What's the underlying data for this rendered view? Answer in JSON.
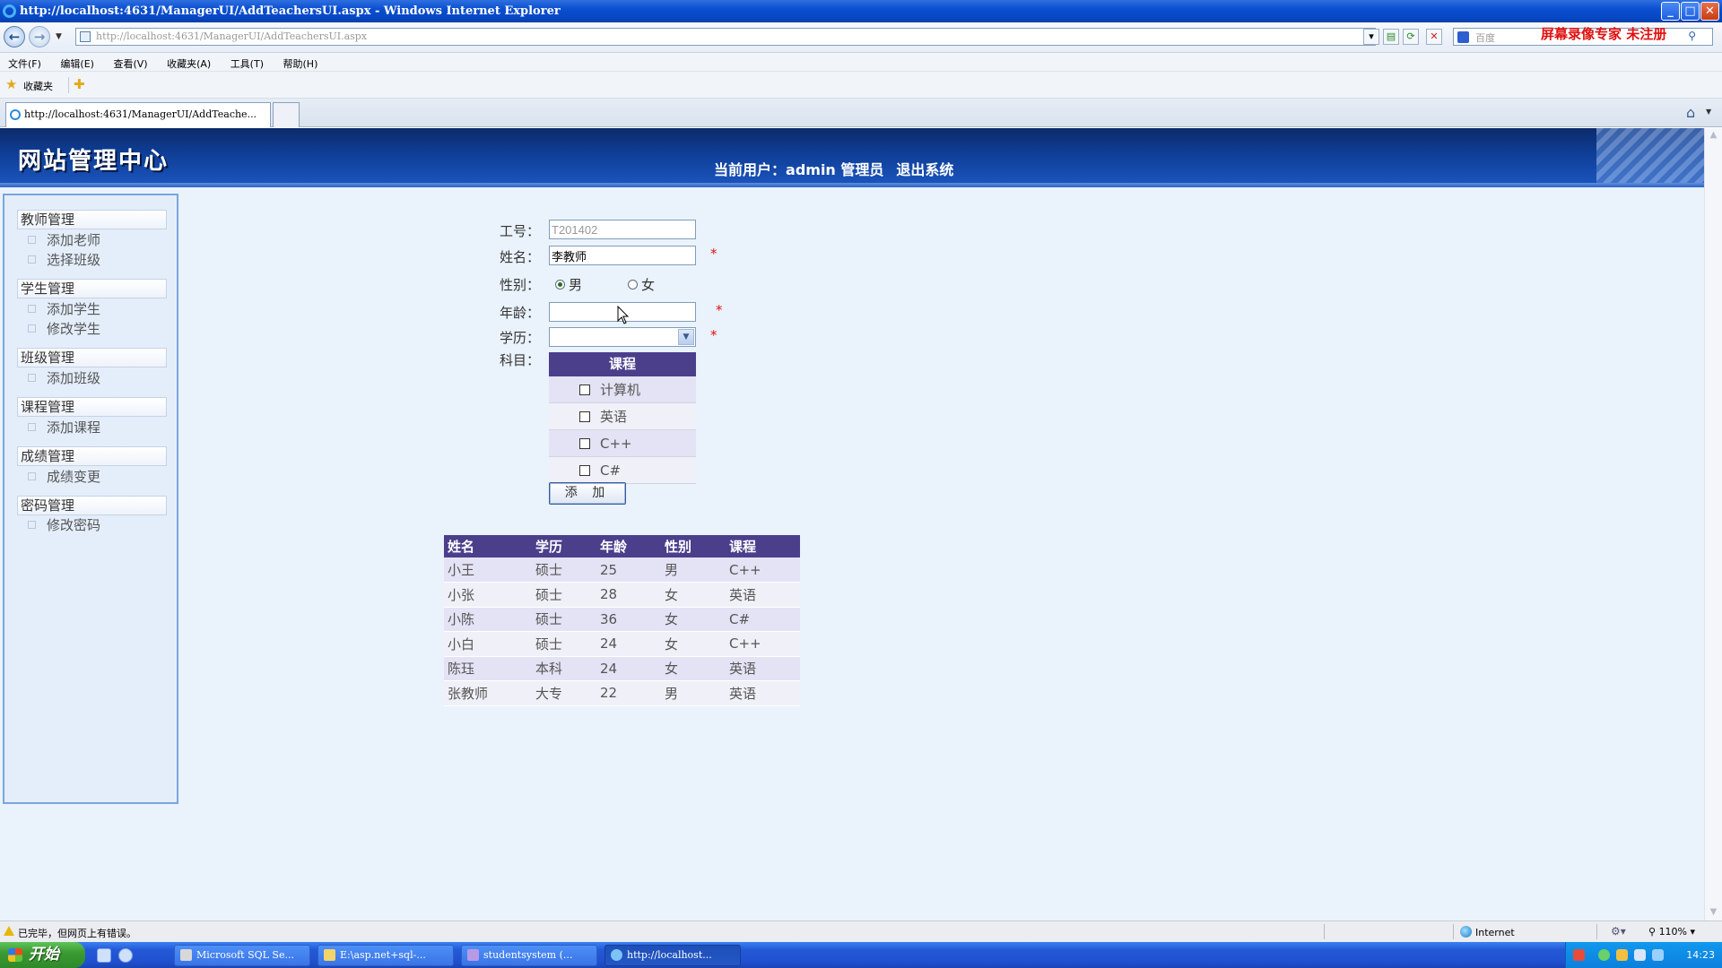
{
  "window": {
    "title": "http://localhost:4631/ManagerUI/AddTeachersUI.aspx - Windows Internet Explorer",
    "min": "_",
    "max": "□",
    "close": "✕"
  },
  "address": {
    "url": "http://localhost:4631/ManagerUI/AddTeachersUI.aspx",
    "search_placeholder": "百度",
    "watermark": "屏幕录像专家  未注册"
  },
  "menu": [
    "文件(F)",
    "编辑(E)",
    "查看(V)",
    "收藏夹(A)",
    "工具(T)",
    "帮助(H)"
  ],
  "favorites": {
    "label": "收藏夹"
  },
  "tabs": [
    {
      "label": "http://localhost:4631/ManagerUI/AddTeache..."
    }
  ],
  "header": {
    "site_title": "网站管理中心",
    "current_user_label": "当前用户：",
    "username": "admin",
    "role": "管理员",
    "logout": "退出系统"
  },
  "sidebar": [
    {
      "category": "教师管理",
      "items": [
        "添加老师",
        "选择班级"
      ]
    },
    {
      "category": "学生管理",
      "items": [
        "添加学生",
        "修改学生"
      ]
    },
    {
      "category": "班级管理",
      "items": [
        "添加班级"
      ]
    },
    {
      "category": "课程管理",
      "items": [
        "添加课程"
      ]
    },
    {
      "category": "成绩管理",
      "items": [
        "成绩变更"
      ]
    },
    {
      "category": "密码管理",
      "items": [
        "修改密码"
      ]
    }
  ],
  "form": {
    "labels": {
      "id": "工号：",
      "name": "姓名：",
      "gender": "性别：",
      "age": "年龄：",
      "edu": "学历：",
      "subject": "科目："
    },
    "id_value": "T201402",
    "name_value": "李教师",
    "age_value": "",
    "edu_value": "",
    "required_mark": "*",
    "gender_options": [
      {
        "label": "男",
        "selected": true
      },
      {
        "label": "女",
        "selected": false
      }
    ],
    "course_header": "课程",
    "courses": [
      "计算机",
      "英语",
      "C++",
      "C#"
    ],
    "add_button": "添 加"
  },
  "table": {
    "headers": [
      "姓名",
      "学历",
      "年龄",
      "性别",
      "课程"
    ],
    "rows": [
      [
        "小王",
        "硕士",
        "25",
        "男",
        "C++"
      ],
      [
        "小张",
        "硕士",
        "28",
        "女",
        "英语"
      ],
      [
        "小陈",
        "硕士",
        "36",
        "女",
        "C#"
      ],
      [
        "小白",
        "硕士",
        "24",
        "女",
        "C++"
      ],
      [
        "陈珏",
        "本科",
        "24",
        "女",
        "英语"
      ],
      [
        "张教师",
        "大专",
        "22",
        "男",
        "英语"
      ]
    ]
  },
  "status": {
    "text": "已完毕，但网页上有错误。",
    "zone": "Internet",
    "zoom": "110%"
  },
  "taskbar": {
    "start": "开始",
    "tasks": [
      "Microsoft SQL Se...",
      "E:\\asp.net+sql-...",
      "studentsystem (...",
      "http://localhost..."
    ],
    "clock": "14:23"
  }
}
